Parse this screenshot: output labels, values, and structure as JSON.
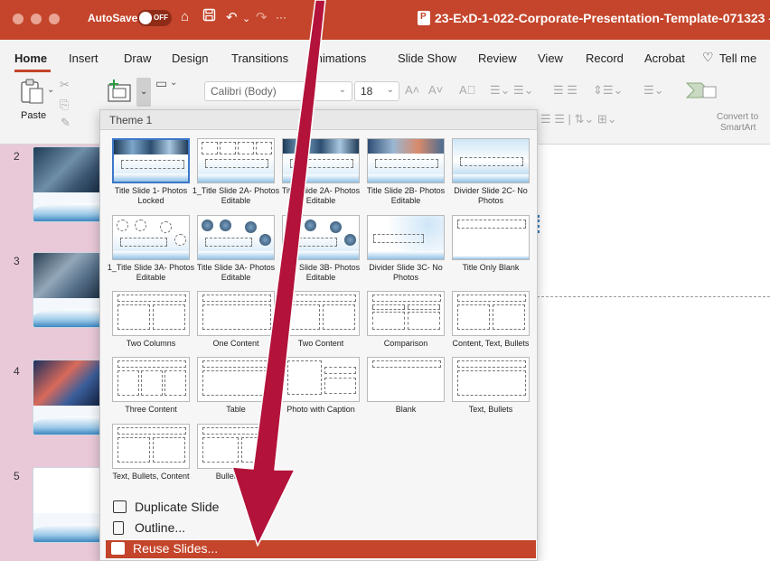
{
  "window": {
    "autosave_label": "AutoSave",
    "autosave_state": "OFF",
    "more": "···",
    "document_title": "23-ExD-1-022-Corporate-Presentation-Template-071323 –"
  },
  "tabs": [
    {
      "label": "Home",
      "active": true
    },
    {
      "label": "Insert"
    },
    {
      "label": "Draw"
    },
    {
      "label": "Design"
    },
    {
      "label": "Transitions"
    },
    {
      "label": "Animations"
    },
    {
      "label": "Slide Show"
    },
    {
      "label": "Review"
    },
    {
      "label": "View"
    },
    {
      "label": "Record"
    },
    {
      "label": "Acrobat"
    },
    {
      "label": "Tell me"
    }
  ],
  "ribbon": {
    "paste_label": "Paste",
    "font_name": "Calibri (Body)",
    "font_size": "18",
    "convert_label_1": "Convert to",
    "convert_label_2": "SmartArt"
  },
  "slides_panel": {
    "numbers": [
      "2",
      "3",
      "4",
      "5"
    ]
  },
  "layout_menu": {
    "header": "Theme 1",
    "layouts": [
      {
        "name": "Title Slide 1- Photos Locked"
      },
      {
        "name": "1_Title Slide 2A- Photos Editable"
      },
      {
        "name": "Title Slide 2A- Photos Editable"
      },
      {
        "name": "Title Slide 2B- Photos Editable"
      },
      {
        "name": "Divider Slide 2C- No Photos"
      },
      {
        "name": "1_Title Slide 3A- Photos Editable"
      },
      {
        "name": "Title Slide 3A- Photos Editable"
      },
      {
        "name": "Title Slide 3B- Photos Editable"
      },
      {
        "name": "Divider Slide 3C- No Photos"
      },
      {
        "name": "Title Only Blank"
      },
      {
        "name": "Two Columns"
      },
      {
        "name": "One Content"
      },
      {
        "name": "Two Content"
      },
      {
        "name": "Comparison"
      },
      {
        "name": "Content, Text, Bullets"
      },
      {
        "name": "Three Content"
      },
      {
        "name": "Table"
      },
      {
        "name": "Photo with Caption"
      },
      {
        "name": "Blank"
      },
      {
        "name": "Text, Bullets"
      },
      {
        "name": "Text, Bullets, Content"
      },
      {
        "name": "Bullets and"
      }
    ],
    "items": {
      "duplicate": "Duplicate Slide",
      "outline": "Outline...",
      "reuse": "Reuse Slides..."
    }
  },
  "colors": {
    "brand": "#c4452b",
    "panel": "#e9c9d7",
    "arrow": "#b3123a",
    "selection": "#3b77c9"
  }
}
